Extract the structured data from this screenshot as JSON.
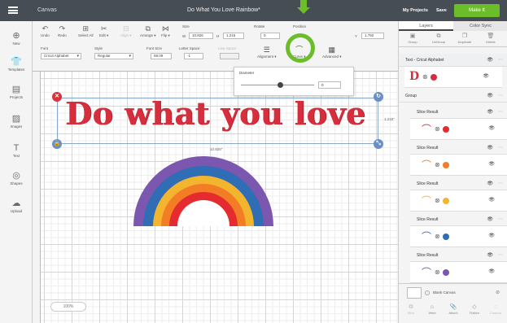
{
  "topbar": {
    "app": "Canvas",
    "doc_title": "Do What You Love Rainbow*",
    "my_projects": "My Projects",
    "save": "Save",
    "make_it": "Make It"
  },
  "toolbar": {
    "undo": "Undo",
    "redo": "Redo",
    "select_all": "Select All",
    "edit": "Edit ▾",
    "align": "Align ▾",
    "arrange": "Arrange ▾",
    "flip": "Flip ▾",
    "size_label": "Size",
    "w_label": "W",
    "w_value": "10.826",
    "h_label": "H",
    "h_value": "1.215",
    "rotate_label": "Rotate",
    "rotate_value": "0",
    "position_label": "Position",
    "y_label": "Y",
    "y_value": "1.792",
    "font_label": "Font",
    "font_value": "Cricut Alphabet",
    "style_label": "Style",
    "style_value": "Regular",
    "fontsize_label": "Font Size",
    "fontsize_value": "68.09",
    "letterspace_label": "Letter Space",
    "letterspace_value": "-1",
    "linespace_label": "Line Space",
    "alignment": "Alignment ▾",
    "curve": "Curve ▾",
    "advanced": "Advanced ▾"
  },
  "leftbar": {
    "items": [
      "New",
      "Templates",
      "Projects",
      "Images",
      "Text",
      "Shapes",
      "Upload"
    ]
  },
  "curve_panel": {
    "title": "Diameter",
    "value": "0"
  },
  "canvas": {
    "text": "Do what you love",
    "width_dim": "10.826\"",
    "height_dim": "1.215\"",
    "zoom": "100%"
  },
  "right": {
    "tab_layers": "Layers",
    "tab_color_sync": "Color Sync",
    "tools": [
      "Group",
      "UnGroup",
      "Duplicate",
      "Delete"
    ],
    "text_layer": "Text - Cricut Alphabet",
    "group": "Group",
    "slice_results": [
      "Slice Result",
      "Slice Result",
      "Slice Result",
      "Slice Result",
      "Slice Result"
    ],
    "blank_canvas": "Blank Canvas",
    "bottom_tools": [
      "Slice",
      "Weld",
      "Attach",
      "Flatten",
      "Contour"
    ]
  },
  "colors": {
    "accent": "#6cbd2a",
    "text_red": "#d62e3c",
    "rainbow": [
      "#7b57b0",
      "#2f6db5",
      "#f4b52e",
      "#f27d25",
      "#e52b2f"
    ]
  }
}
